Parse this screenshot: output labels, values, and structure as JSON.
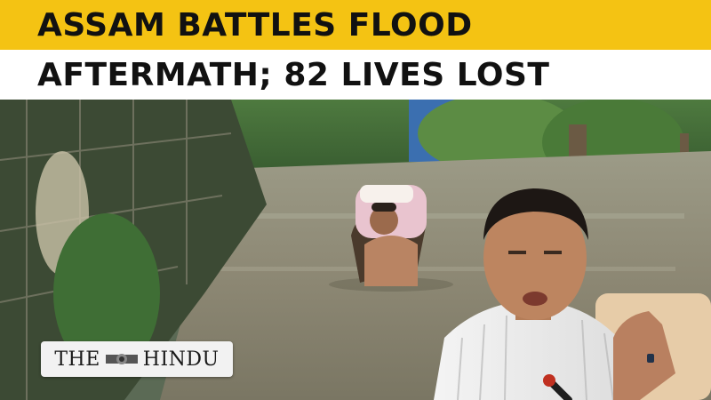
{
  "headline": {
    "line1": "ASSAM BATTLES FLOOD",
    "line2": "AFTERMATH; 82 LIVES LOST"
  },
  "logo": {
    "part1": "THE",
    "part2": "HINDU",
    "seal_icon": "emblem-icon"
  },
  "colors": {
    "headline_yellow": "#f4c313",
    "headline_white": "#ffffff",
    "text": "#111111"
  }
}
